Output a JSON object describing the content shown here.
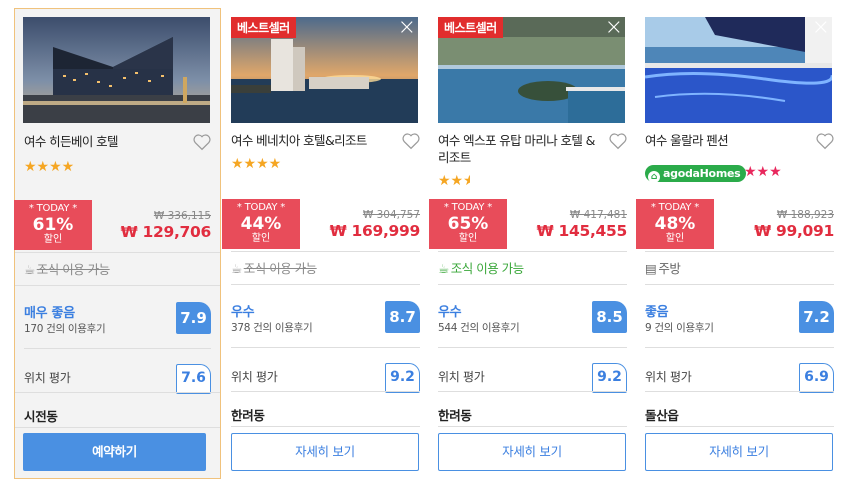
{
  "cards": [
    {
      "name": "여수 히든베이 호텔",
      "stars": "★★★★",
      "badge": "",
      "today": "* TODAY *",
      "discount": "61%",
      "discount_label": "할인",
      "original_price": "₩ 336,115",
      "price": "₩ 129,706",
      "amenity": "조식 이용 가능",
      "rating_label": "매우 좋음",
      "reviews": "170 건의 이용후기",
      "score": "7.9",
      "location_label": "위치 평가",
      "location_score": "7.6",
      "area": "시전동",
      "button": "예약하기"
    },
    {
      "name": "여수 베네치아 호텔&리조트",
      "stars": "★★★★",
      "badge": "베스트셀러",
      "today": "* TODAY *",
      "discount": "44%",
      "discount_label": "할인",
      "original_price": "₩ 304,757",
      "price": "₩ 169,999",
      "amenity": "조식 이용 가능",
      "rating_label": "우수",
      "reviews": "378 건의 이용후기",
      "score": "8.7",
      "location_label": "위치 평가",
      "location_score": "9.2",
      "area": "한려동",
      "button": "자세히 보기"
    },
    {
      "name": "여수 엑스포 유탑 마리나 호텔 & 리조트",
      "stars": "★★★",
      "badge": "베스트셀러",
      "today": "* TODAY *",
      "discount": "65%",
      "discount_label": "할인",
      "original_price": "₩ 417,481",
      "price": "₩ 145,455",
      "amenity": "조식 이용 가능",
      "rating_label": "우수",
      "reviews": "544 건의 이용후기",
      "score": "8.5",
      "location_label": "위치 평가",
      "location_score": "9.2",
      "area": "한려동",
      "button": "자세히 보기"
    },
    {
      "name": "여수 울랄라 펜션",
      "stars": "★★★",
      "badge": "",
      "brand": "agodaHomes",
      "today": "* TODAY *",
      "discount": "48%",
      "discount_label": "할인",
      "original_price": "₩ 188,923",
      "price": "₩ 99,091",
      "amenity": "주방",
      "rating_label": "좋음",
      "reviews": "9 건의 이용후기",
      "score": "7.2",
      "location_label": "위치 평가",
      "location_score": "6.9",
      "area": "돌산읍",
      "button": "자세히 보기"
    }
  ],
  "star_ratings": [
    4,
    4,
    2.5,
    3
  ],
  "colors": {
    "accent_blue": "#4a90e2",
    "deal_red": "#e84c5a",
    "price_red": "#e12d3f",
    "star_orange": "#f5a623",
    "star_pink": "#e8285d",
    "amenity_green": "#3aa73a",
    "agoda_green": "#2bab4a"
  }
}
